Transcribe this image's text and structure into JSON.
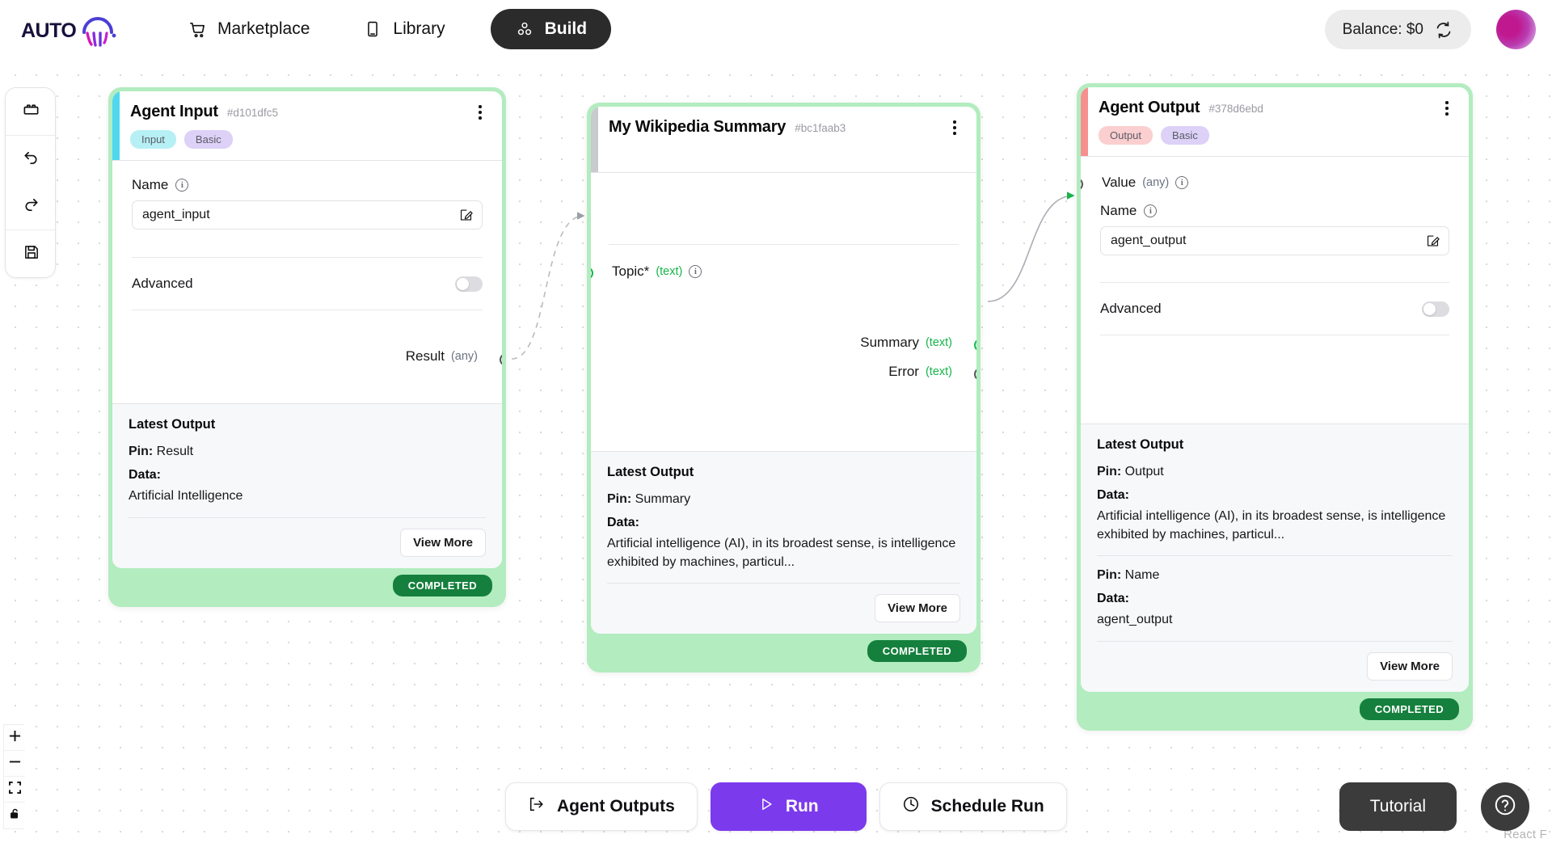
{
  "nav": {
    "logo_text": "AUTO",
    "logo_icon": "autogpt-swirl-logo",
    "items": [
      {
        "label": "Marketplace",
        "icon": "shopping-cart-icon",
        "active": false
      },
      {
        "label": "Library",
        "icon": "book-icon",
        "active": false
      },
      {
        "label": "Build",
        "icon": "blocks-icon",
        "active": true
      }
    ],
    "balance_label": "Balance: $0",
    "balance_refresh_icon": "refresh-icon",
    "avatar": "user-avatar"
  },
  "dock": {
    "items": [
      {
        "name": "blocks-icon"
      },
      {
        "name": "undo-icon"
      },
      {
        "name": "redo-icon"
      },
      {
        "name": "save-icon"
      }
    ]
  },
  "zoom_controls": {
    "items": [
      {
        "name": "zoom-in-icon",
        "label": "+"
      },
      {
        "name": "zoom-out-icon",
        "label": "−"
      },
      {
        "name": "fit-view-icon"
      },
      {
        "name": "lock-icon"
      }
    ]
  },
  "nodes": [
    {
      "title": "Agent Input",
      "id": "#d101dfc5",
      "accent_color": "#4fd8ed",
      "badges": [
        {
          "label": "Input",
          "kind": "input"
        },
        {
          "label": "Basic",
          "kind": "basic"
        }
      ],
      "name_field": {
        "label": "Name",
        "value": "agent_input"
      },
      "advanced_label": "Advanced",
      "output_pin": {
        "label": "Result",
        "type": "(any)"
      },
      "latest": {
        "heading": "Latest Output",
        "entries": [
          {
            "pin_label": "Pin:",
            "pin_value": "Result",
            "data_label": "Data:",
            "data_value": "Artificial Intelligence"
          }
        ],
        "view_more": "View More"
      },
      "status": "COMPLETED"
    },
    {
      "title": "My Wikipedia Summary",
      "id": "#bc1faab3",
      "accent_color": "#c9cace",
      "badges": [],
      "input_pin": {
        "label": "Topic*",
        "type": "(text)"
      },
      "output_pins": [
        {
          "label": "Summary",
          "type": "(text)",
          "connected": true
        },
        {
          "label": "Error",
          "type": "(text)",
          "connected": false
        }
      ],
      "latest": {
        "heading": "Latest Output",
        "entries": [
          {
            "pin_label": "Pin:",
            "pin_value": "Summary",
            "data_label": "Data:",
            "data_value": "Artificial intelligence (AI), in its broadest sense, is intelligence exhibited by machines, particul..."
          }
        ],
        "view_more": "View More"
      },
      "status": "COMPLETED"
    },
    {
      "title": "Agent Output",
      "id": "#378d6ebd",
      "accent_color": "#f6908f",
      "badges": [
        {
          "label": "Output",
          "kind": "output"
        },
        {
          "label": "Basic",
          "kind": "basic"
        }
      ],
      "input_pin": {
        "label": "Value",
        "type": "(any)"
      },
      "name_field": {
        "label": "Name",
        "value": "agent_output"
      },
      "advanced_label": "Advanced",
      "latest": {
        "heading": "Latest Output",
        "entries": [
          {
            "pin_label": "Pin:",
            "pin_value": "Output",
            "data_label": "Data:",
            "data_value": "Artificial intelligence (AI), in its broadest sense, is intelligence exhibited by machines, particul..."
          },
          {
            "pin_label": "Pin:",
            "pin_value": "Name",
            "data_label": "Data:",
            "data_value": "agent_output"
          }
        ],
        "view_more": "View More"
      },
      "status": "COMPLETED"
    }
  ],
  "bottom_bar": {
    "agent_outputs": {
      "label": "Agent Outputs",
      "icon": "export-icon"
    },
    "run": {
      "label": "Run",
      "icon": "play-icon",
      "color": "#7c3aed"
    },
    "schedule_run": {
      "label": "Schedule Run",
      "icon": "clock-icon"
    },
    "tutorial": {
      "label": "Tutorial"
    },
    "help": {
      "icon": "question-circle-icon"
    }
  },
  "watermark": "React F"
}
